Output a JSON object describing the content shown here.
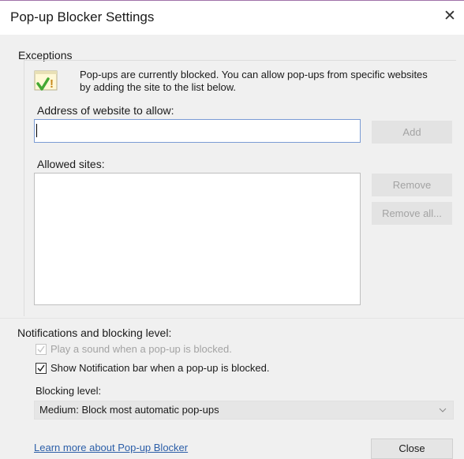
{
  "window": {
    "title": "Pop-up Blocker Settings",
    "close_glyph": "✕"
  },
  "exceptions": {
    "group_label": "Exceptions",
    "info_text": "Pop-ups are currently blocked.  You can allow pop-ups from specific websites by adding the site to the list below.",
    "info_icon": "warning-shield-check-icon",
    "address_label": "Address of website to allow:",
    "address_value": "",
    "add_button": "Add",
    "allowed_label": "Allowed sites:",
    "allowed_sites": [],
    "remove_button": "Remove",
    "remove_all_button": "Remove all..."
  },
  "notifications": {
    "group_label": "Notifications and blocking level:",
    "play_sound_label": "Play a sound when a pop-up is blocked.",
    "play_sound_checked": true,
    "play_sound_enabled": false,
    "show_bar_label": "Show Notification bar when a pop-up is blocked.",
    "show_bar_checked": true,
    "blocking_level_label": "Blocking level:",
    "blocking_level_value": "Medium: Block most automatic pop-ups"
  },
  "footer": {
    "learn_more_link": "Learn more about Pop-up Blocker",
    "close_button": "Close"
  },
  "colors": {
    "title_border": "#a071a9",
    "link": "#2b5ea8",
    "disabled_text": "#a3a3a3",
    "input_border_focus": "#7a9bd4"
  }
}
